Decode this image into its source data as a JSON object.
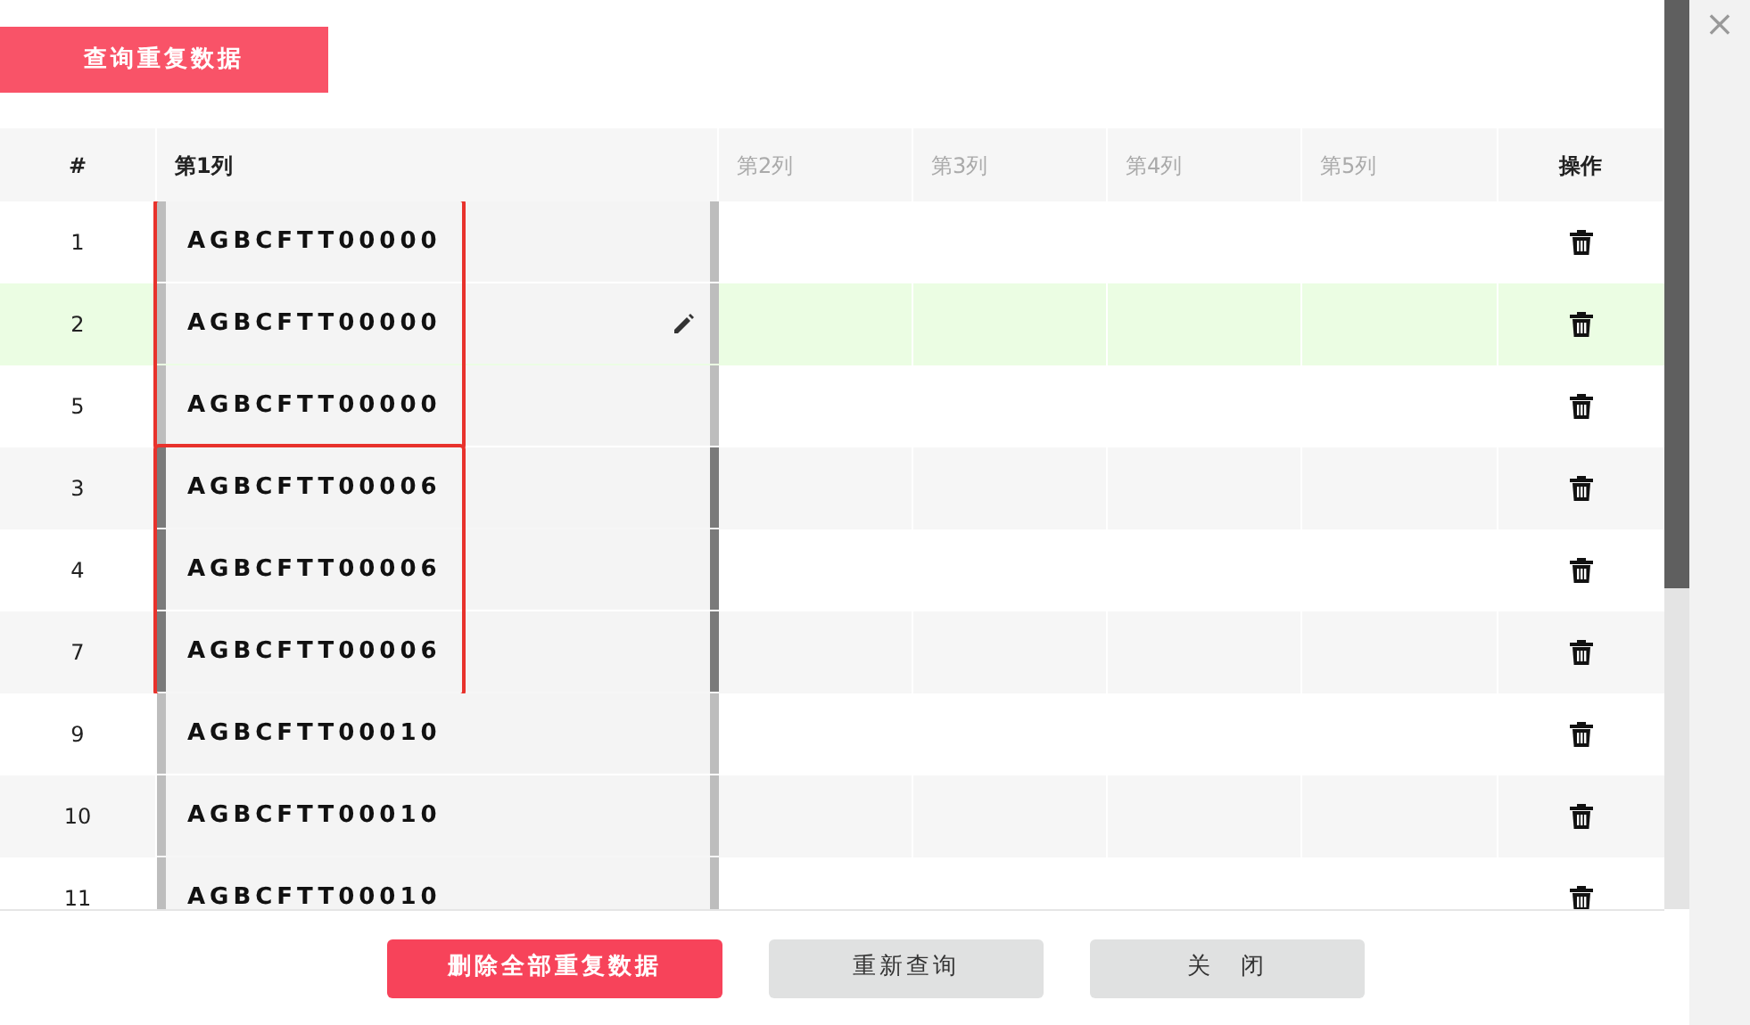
{
  "query_button": "查询重复数据",
  "close_icon": "×",
  "table": {
    "columns": [
      {
        "label": "#",
        "enabled": true
      },
      {
        "label": "第1列",
        "enabled": true
      },
      {
        "label": "第2列",
        "enabled": false
      },
      {
        "label": "第3列",
        "enabled": false
      },
      {
        "label": "第4列",
        "enabled": false
      },
      {
        "label": "第5列",
        "enabled": false
      },
      {
        "label": "操作",
        "enabled": true
      }
    ],
    "groups": [
      {
        "outlined": true,
        "color": "#bdbdbd",
        "rows": [
          {
            "number": "1",
            "value": "AGBCFTT00000",
            "selected": false,
            "editing": false
          },
          {
            "number": "2",
            "value": "AGBCFTT00000",
            "selected": true,
            "editing": true
          },
          {
            "number": "5",
            "value": "AGBCFTT00000",
            "selected": false,
            "editing": false
          }
        ]
      },
      {
        "outlined": true,
        "color": "#7a7a7a",
        "rows": [
          {
            "number": "3",
            "value": "AGBCFTT00006",
            "selected": false,
            "editing": false
          },
          {
            "number": "4",
            "value": "AGBCFTT00006",
            "selected": false,
            "editing": false
          },
          {
            "number": "7",
            "value": "AGBCFTT00006",
            "selected": false,
            "editing": false
          }
        ]
      },
      {
        "outlined": false,
        "color": "#bdbdbd",
        "rows": [
          {
            "number": "9",
            "value": "AGBCFTT00010",
            "selected": false,
            "editing": false
          },
          {
            "number": "10",
            "value": "AGBCFTT00010",
            "selected": false,
            "editing": false
          },
          {
            "number": "11",
            "value": "AGBCFTT00010",
            "selected": false,
            "editing": false
          }
        ]
      }
    ]
  },
  "footer_buttons": [
    {
      "label": "删除全部重复数据",
      "kind": "danger"
    },
    {
      "label": "重新查询",
      "kind": "default"
    },
    {
      "label": "关　闭",
      "kind": "default"
    }
  ]
}
